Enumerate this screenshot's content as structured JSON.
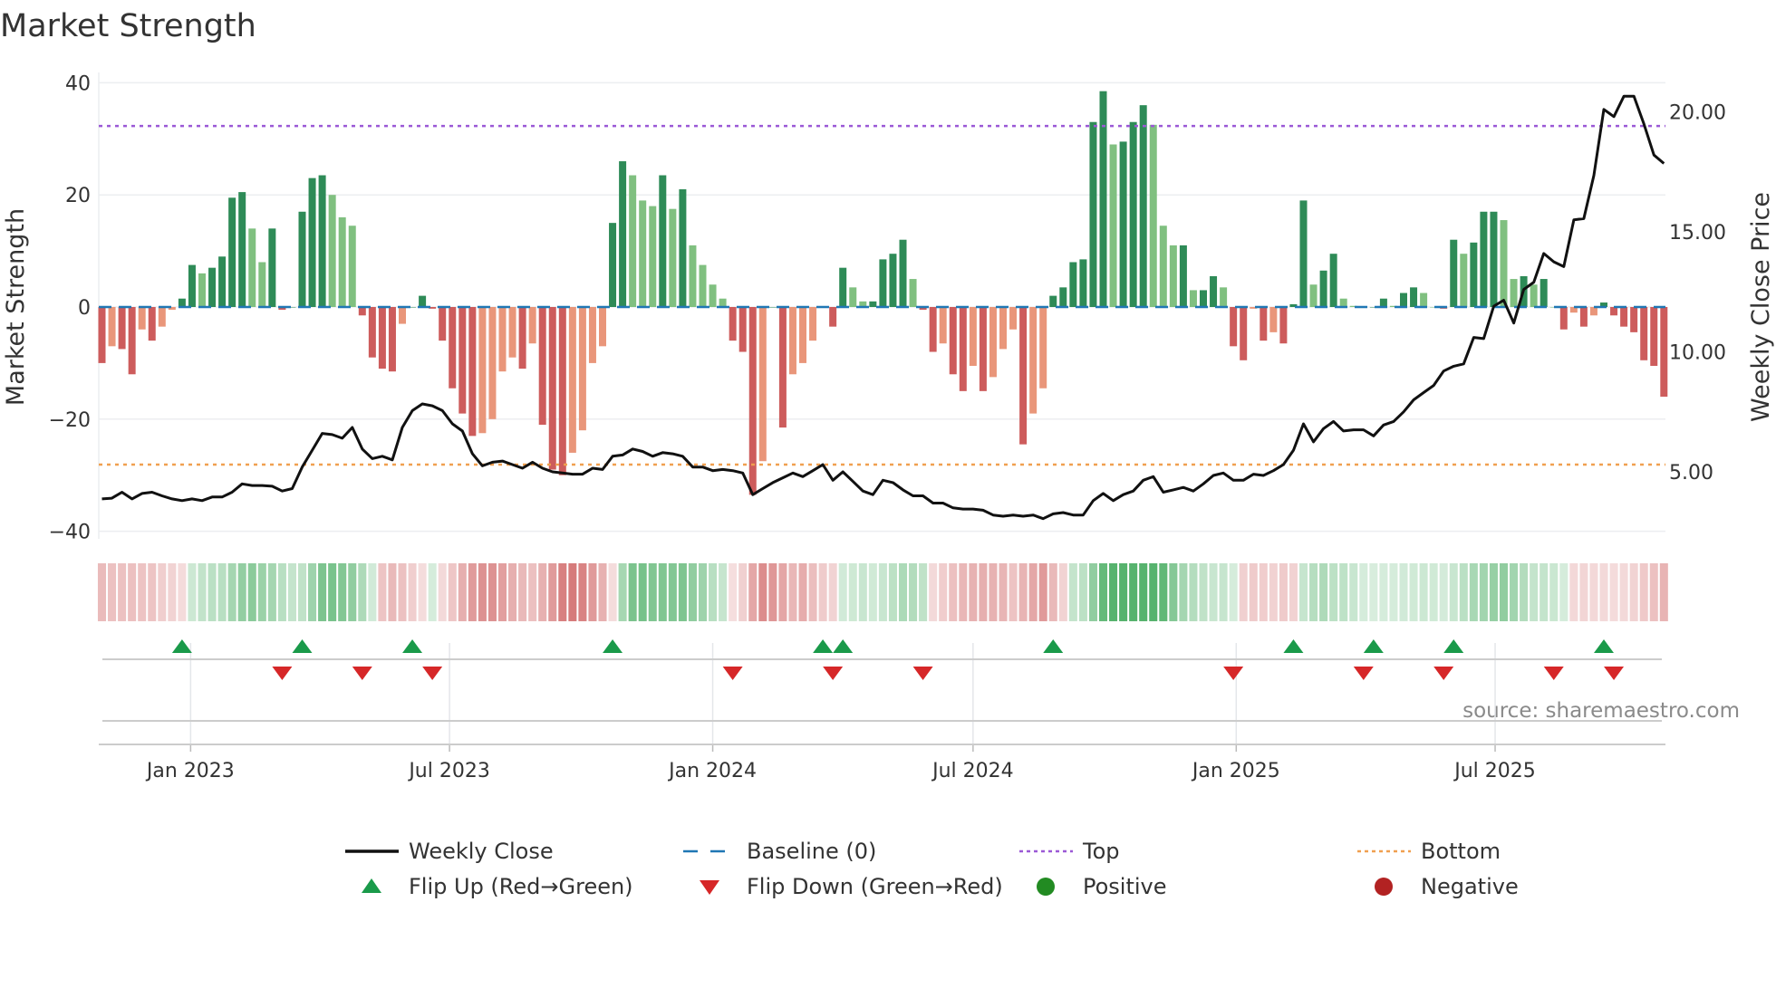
{
  "chart_data": {
    "type": "bar+line",
    "title": "Market Strength",
    "ylabel": "Market Strength",
    "y2label": "Weekly Close Price",
    "ylim": [
      -42,
      42
    ],
    "y_ticks": [
      "40",
      "20",
      "0",
      "−20",
      "−40"
    ],
    "y_tick_values": [
      40,
      20,
      0,
      -20,
      -40
    ],
    "y2_ticks": [
      "20.00",
      "15.00",
      "10.00",
      "5.00"
    ],
    "y2_tick_values": [
      20,
      15,
      10,
      5
    ],
    "start_date": "2022-10-31",
    "frequency": "weekly",
    "x_ticks": [
      {
        "label": "Jan 2023",
        "date": "2023-01-01"
      },
      {
        "label": "Jul 2023",
        "date": "2023-07-01"
      },
      {
        "label": "Jan 2024",
        "date": "2024-01-01"
      },
      {
        "label": "Jul 2024",
        "date": "2024-07-01"
      },
      {
        "label": "Jan 2025",
        "date": "2025-01-01"
      },
      {
        "label": "Jul 2025",
        "date": "2025-07-01"
      }
    ],
    "top_level": 32.3,
    "bottom_level": -28.1,
    "strength": [
      -10,
      -7,
      -7.5,
      -12,
      -4,
      -6,
      -3.5,
      -0.5,
      1.5,
      7.5,
      6,
      7,
      9,
      19.5,
      20.5,
      14,
      8,
      14,
      -0.5,
      0,
      17,
      23,
      23.5,
      20,
      16,
      14.5,
      -1.5,
      -9,
      -11,
      -11.5,
      -3,
      0,
      2,
      -0.3,
      -6,
      -14.5,
      -19,
      -23,
      -22.5,
      -20,
      -11.5,
      -9,
      -11,
      -6.5,
      -21,
      -29,
      -30,
      -26,
      -22,
      -10,
      -7,
      15,
      26,
      23.5,
      19,
      18,
      23.5,
      17.5,
      21,
      11,
      7.5,
      4,
      1.5,
      -6,
      -8,
      -33.5,
      -27.5,
      0,
      -21.5,
      -12,
      -10,
      -6,
      0,
      -3.5,
      7,
      3.5,
      1,
      1,
      8.5,
      9.5,
      12,
      5,
      -0.5,
      -8,
      -6.5,
      -12,
      -15,
      -10.5,
      -15,
      -12.5,
      -7.5,
      -4,
      -24.5,
      -19,
      -14.5,
      2,
      3.5,
      8,
      8.5,
      33,
      38.5,
      29,
      29.5,
      33,
      36,
      32.5,
      14.5,
      11,
      11,
      3,
      3,
      5.5,
      3.5,
      -7,
      -9.5,
      -0.3,
      -6,
      -4.5,
      -6.5,
      0.5,
      19,
      4,
      6.5,
      9.5,
      1.5,
      0.2,
      0,
      0,
      1.5,
      0.2,
      2.5,
      3.5,
      2.5,
      0,
      -0.3,
      12,
      9.5,
      11.5,
      17,
      17,
      15.5,
      5,
      5.5,
      4,
      5,
      0,
      -4,
      -1,
      -3.5,
      -1.5,
      0.8,
      -1.5,
      -3.5,
      -4.5,
      -9.5,
      -10.5,
      -16
    ],
    "weekly_close": [
      3.87,
      3.9,
      4.15,
      3.87,
      4.1,
      4.15,
      4.0,
      3.87,
      3.8,
      3.87,
      3.8,
      3.95,
      3.95,
      4.15,
      4.5,
      4.43,
      4.43,
      4.4,
      4.2,
      4.3,
      5.2,
      5.9,
      6.6,
      6.55,
      6.4,
      6.85,
      5.95,
      5.55,
      5.65,
      5.5,
      6.85,
      7.55,
      7.83,
      7.75,
      7.55,
      7.0,
      6.7,
      5.75,
      5.25,
      5.4,
      5.45,
      5.3,
      5.15,
      5.4,
      5.15,
      5.0,
      4.95,
      4.9,
      4.9,
      5.15,
      5.1,
      5.65,
      5.7,
      5.95,
      5.85,
      5.65,
      5.8,
      5.75,
      5.65,
      5.2,
      5.2,
      5.05,
      5.1,
      5.05,
      4.95,
      4.05,
      4.3,
      4.55,
      4.75,
      4.95,
      4.8,
      5.05,
      5.3,
      4.65,
      5.0,
      4.6,
      4.2,
      4.05,
      4.65,
      4.55,
      4.25,
      4.0,
      4.0,
      3.7,
      3.7,
      3.5,
      3.45,
      3.45,
      3.4,
      3.2,
      3.15,
      3.2,
      3.15,
      3.2,
      3.05,
      3.25,
      3.3,
      3.2,
      3.2,
      3.8,
      4.1,
      3.8,
      4.05,
      4.2,
      4.65,
      4.8,
      4.15,
      4.25,
      4.35,
      4.2,
      4.5,
      4.85,
      4.95,
      4.65,
      4.65,
      4.9,
      4.85,
      5.05,
      5.3,
      5.9,
      7.0,
      6.25,
      6.8,
      7.1,
      6.7,
      6.75,
      6.75,
      6.5,
      6.95,
      7.1,
      7.5,
      8.0,
      8.3,
      8.6,
      9.2,
      9.4,
      9.5,
      10.6,
      10.55,
      11.9,
      12.15,
      11.2,
      12.6,
      12.9,
      14.1,
      13.75,
      13.55,
      15.5,
      15.55,
      17.35,
      20.1,
      19.8,
      20.65,
      20.65,
      19.5,
      18.2,
      17.85
    ],
    "y2lim": [
      2.0,
      21.8
    ],
    "flip_up_dates": [
      "2022-12-26",
      "2023-03-20",
      "2023-06-05",
      "2023-10-23",
      "2024-03-18",
      "2024-04-01",
      "2024-08-26",
      "2025-02-10",
      "2025-04-07",
      "2025-06-02",
      "2025-09-15"
    ],
    "flip_down_dates": [
      "2023-03-06",
      "2023-05-01",
      "2023-06-19",
      "2024-01-15",
      "2024-03-25",
      "2024-05-27",
      "2024-12-30",
      "2025-03-31",
      "2025-05-26",
      "2025-08-11",
      "2025-09-22"
    ],
    "colors": {
      "green_strong": "#2e8b57",
      "green_weak": "#80c080",
      "red_strong": "#cd5c5c",
      "red_weak": "#e9967a",
      "baseline": "#1f77b4",
      "top": "#9b59d6",
      "bottom": "#f0a050",
      "flip_up": "#1a9a4a",
      "flip_down": "#d62728",
      "positive": "#228b22",
      "negative": "#b22222",
      "strip_green": "#3aa655",
      "strip_red": "#cd5c5c"
    },
    "legend": {
      "placement": "bottom",
      "items": [
        {
          "label": "Weekly Close",
          "symbol": "line"
        },
        {
          "label": "Baseline (0)",
          "symbol": "dash"
        },
        {
          "label": "Top",
          "symbol": "dot-purple"
        },
        {
          "label": "Bottom",
          "symbol": "dot-orange"
        },
        {
          "label": "Flip Up (Red→Green)",
          "symbol": "triangle-up"
        },
        {
          "label": "Flip Down (Green→Red)",
          "symbol": "triangle-down"
        },
        {
          "label": "Positive",
          "symbol": "circle-green"
        },
        {
          "label": "Negative",
          "symbol": "circle-red"
        }
      ]
    },
    "source": "source: sharemaestro.com"
  }
}
